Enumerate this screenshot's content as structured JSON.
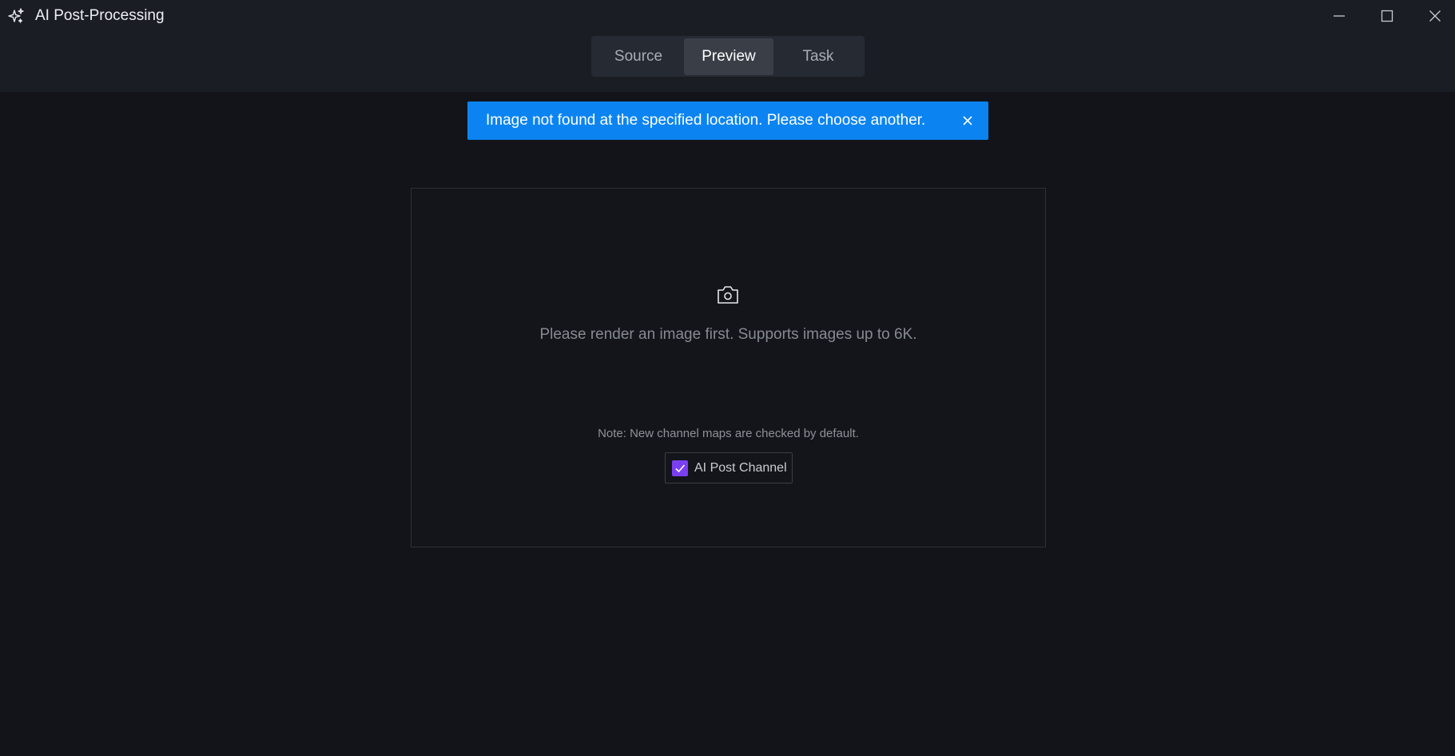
{
  "window": {
    "title": "AI Post-Processing",
    "icon": "sparkle-icon"
  },
  "tabs": [
    {
      "label": "Source",
      "active": false
    },
    {
      "label": "Preview",
      "active": true
    },
    {
      "label": "Task",
      "active": false
    }
  ],
  "toast": {
    "message": "Image not found at the specified location. Please choose another.",
    "color": "#0b84f2"
  },
  "preview": {
    "icon": "camera-icon",
    "message": "Please render an image first. Supports images up to 6K.",
    "note": "Note: New channel maps are checked by default.",
    "channel": {
      "label": "AI Post Channel",
      "checked": true,
      "check_color": "#7b3ff2"
    }
  }
}
